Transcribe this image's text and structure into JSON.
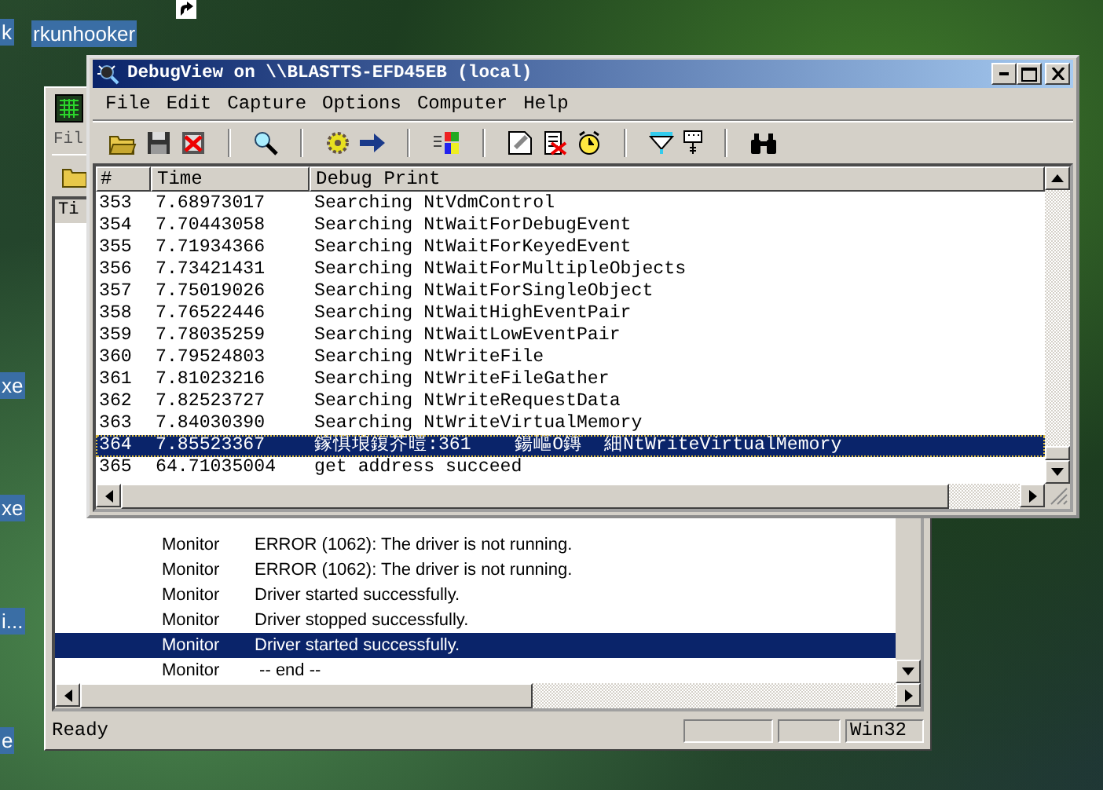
{
  "desktop_icons": [
    {
      "label": "k"
    },
    {
      "label": "rkunhooker"
    },
    {
      "label": "xe"
    },
    {
      "label": "xe"
    },
    {
      "label": "i..."
    },
    {
      "label": "e"
    }
  ],
  "back_window": {
    "menu": [
      "Fil"
    ],
    "column": "Ti",
    "rows": [
      {
        "source": "Monitor",
        "message": "ERROR (1062): The driver is not running.",
        "selected": false
      },
      {
        "source": "Monitor",
        "message": "ERROR (1062): The driver is not running.",
        "selected": false
      },
      {
        "source": "Monitor",
        "message": "Driver started successfully.",
        "selected": false
      },
      {
        "source": "Monitor",
        "message": "Driver stopped successfully.",
        "selected": false
      },
      {
        "source": "Monitor",
        "message": "Driver started successfully.",
        "selected": true
      },
      {
        "source": "Monitor",
        "message": " -- end --",
        "selected": false
      }
    ],
    "status_bar": {
      "text": "Ready",
      "platform": "Win32"
    }
  },
  "window": {
    "title": "DebugView on \\\\BLASTTS-EFD45EB (local)",
    "menu": [
      "File",
      "Edit",
      "Capture",
      "Options",
      "Computer",
      "Help"
    ],
    "columns": [
      "#",
      "Time",
      "Debug Print"
    ],
    "rows": [
      {
        "number": "353",
        "time": "7.68973017",
        "text": "Searching NtVdmControl",
        "selected": false
      },
      {
        "number": "354",
        "time": "7.70443058",
        "text": "Searching NtWaitForDebugEvent",
        "selected": false
      },
      {
        "number": "355",
        "time": "7.71934366",
        "text": "Searching NtWaitForKeyedEvent",
        "selected": false
      },
      {
        "number": "356",
        "time": "7.73421431",
        "text": "Searching NtWaitForMultipleObjects",
        "selected": false
      },
      {
        "number": "357",
        "time": "7.75019026",
        "text": "Searching NtWaitForSingleObject",
        "selected": false
      },
      {
        "number": "358",
        "time": "7.76522446",
        "text": "Searching NtWaitHighEventPair",
        "selected": false
      },
      {
        "number": "359",
        "time": "7.78035259",
        "text": "Searching NtWaitLowEventPair",
        "selected": false
      },
      {
        "number": "360",
        "time": "7.79524803",
        "text": "Searching NtWriteFile",
        "selected": false
      },
      {
        "number": "361",
        "time": "7.81023216",
        "text": "Searching NtWriteFileGather",
        "selected": false
      },
      {
        "number": "362",
        "time": "7.82523727",
        "text": "Searching NtWriteRequestData",
        "selected": false
      },
      {
        "number": "363",
        "time": "7.84030390",
        "text": "Searching NtWriteVirtualMemory",
        "selected": false
      },
      {
        "number": "364",
        "time": "7.85523367",
        "text": "鎵惧埌鍑芥暟:361    鍚嶇О鏄  細NtWriteVirtualMemory",
        "selected": true
      },
      {
        "number": "365",
        "time": "64.71035004",
        "text": "get address succeed",
        "selected": false
      }
    ]
  }
}
